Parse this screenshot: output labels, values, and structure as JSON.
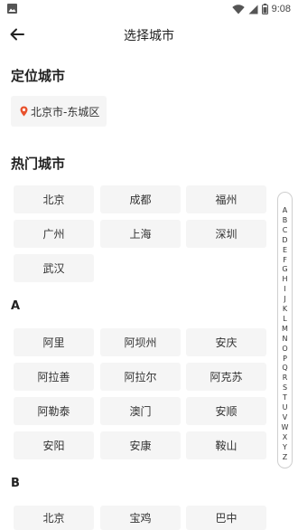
{
  "status_bar": {
    "time": "9:08",
    "icons": [
      "image-icon",
      "wifi-icon",
      "signal-icon",
      "battery-icon"
    ]
  },
  "header": {
    "title": "选择城市",
    "back_icon": "arrow-left-icon"
  },
  "location": {
    "title": "定位城市",
    "city": "北京市-东城区",
    "icon": "location-pin-icon",
    "accent": "#e8522d"
  },
  "hot": {
    "title": "热门城市",
    "cities": [
      "北京",
      "成都",
      "福州",
      "广州",
      "上海",
      "深圳",
      "武汉"
    ]
  },
  "groups": [
    {
      "letter": "A",
      "cities": [
        "阿里",
        "阿坝州",
        "安庆",
        "阿拉善",
        "阿拉尔",
        "阿克苏",
        "阿勒泰",
        "澳门",
        "安顺",
        "安阳",
        "安康",
        "鞍山"
      ]
    },
    {
      "letter": "B",
      "cities": [
        "北京",
        "宝鸡",
        "巴中"
      ]
    }
  ],
  "index_letters": [
    "A",
    "B",
    "C",
    "D",
    "E",
    "F",
    "G",
    "H",
    "I",
    "J",
    "K",
    "L",
    "M",
    "N",
    "O",
    "P",
    "Q",
    "R",
    "S",
    "T",
    "U",
    "V",
    "W",
    "X",
    "Y",
    "Z"
  ]
}
